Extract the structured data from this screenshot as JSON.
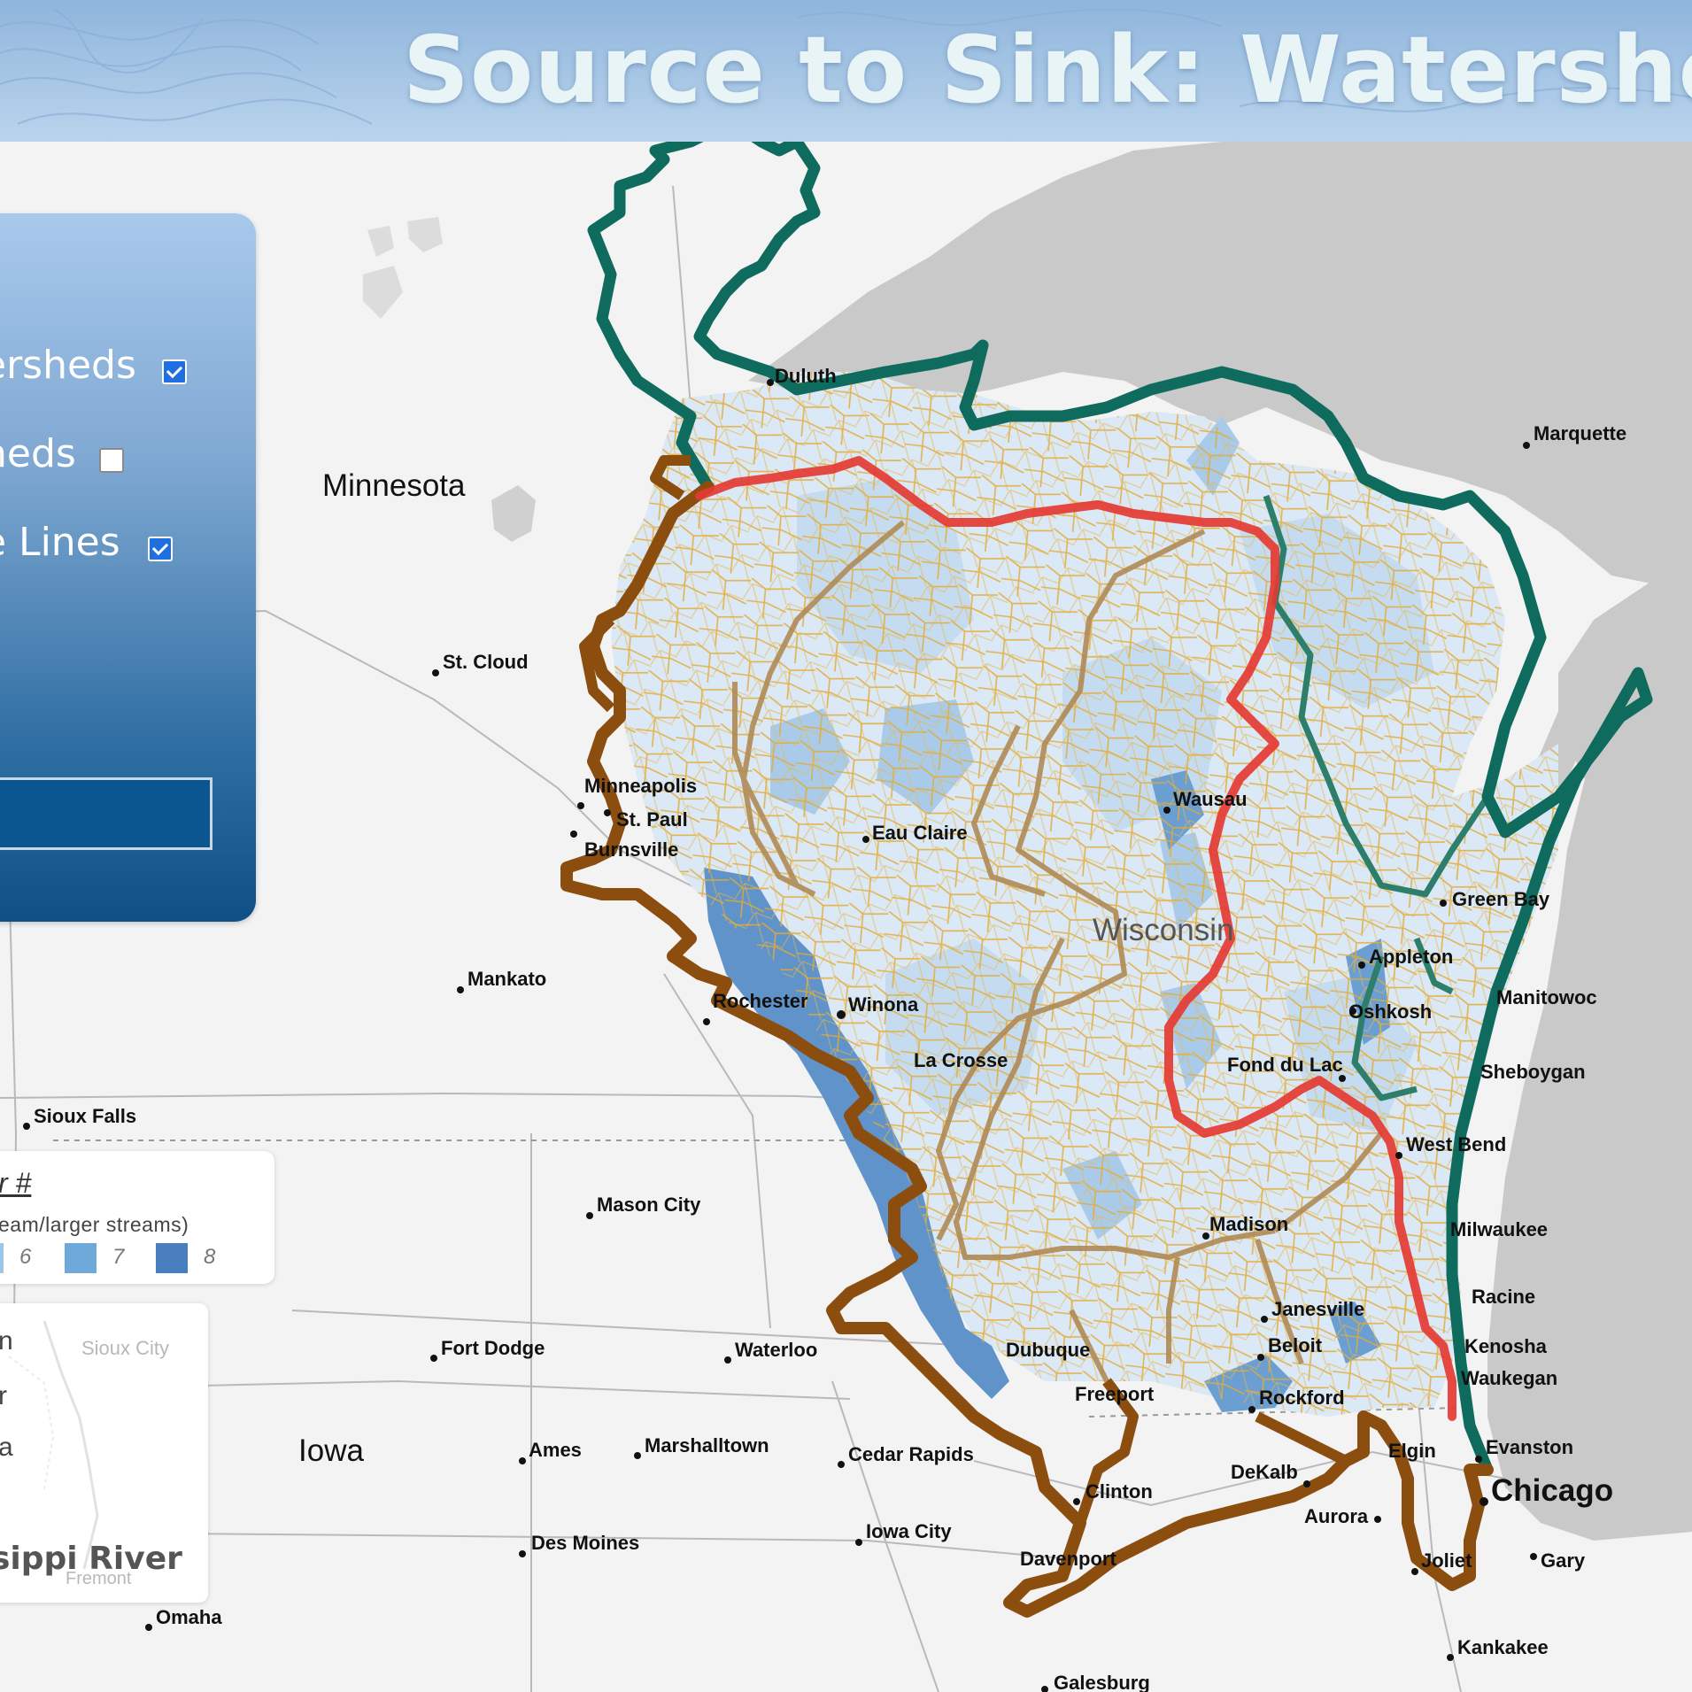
{
  "header": {
    "title": "Source to Sink: Watershed View"
  },
  "layers_panel": {
    "items": [
      {
        "label": "ersheds",
        "checked": true
      },
      {
        "label": "heds",
        "checked": false
      },
      {
        "label": "e Lines",
        "checked": true
      }
    ]
  },
  "legend": {
    "title": "r #",
    "subtitle": "eam/larger streams)",
    "classes": [
      {
        "label": "6",
        "color": "#9cc5e6"
      },
      {
        "label": "7",
        "color": "#6ea9d9"
      },
      {
        "label": "8",
        "color": "#4a7fbf"
      }
    ]
  },
  "overview_map": {
    "line1": "n",
    "line2": "r",
    "line3": "a",
    "river_label": "sippi River",
    "city1": "Sioux City",
    "city2": "Fremont"
  },
  "map": {
    "state_labels": [
      "Minnesota",
      "Iowa",
      "Wisconsin"
    ],
    "cities": [
      "Duluth",
      "Marquette",
      "St. Cloud",
      "Minneapolis",
      "St. Paul",
      "Burnsville",
      "Eau Claire",
      "Wausau",
      "Green Bay",
      "Appleton",
      "Oshkosh",
      "Manitowoc",
      "Sheboygan",
      "Fond du Lac",
      "West Bend",
      "Milwaukee",
      "Racine",
      "Kenosha",
      "Waukegan",
      "Evanston",
      "Chicago",
      "Gary",
      "Joliet",
      "Kankakee",
      "Elgin",
      "DeKalb",
      "Aurora",
      "Rockford",
      "Beloit",
      "Janesville",
      "Madison",
      "Freeport",
      "Dubuque",
      "Clinton",
      "Davenport",
      "Galesburg",
      "Iowa City",
      "Cedar Rapids",
      "Waterloo",
      "Marshalltown",
      "Ames",
      "Des Moines",
      "Fort Dodge",
      "Mason City",
      "Mankato",
      "Rochester",
      "Winona",
      "La Crosse",
      "Sioux Falls",
      "Omaha"
    ],
    "colors": {
      "outer_basin_green": "#0f6b5e",
      "mississippi_brown": "#8b4e0f",
      "divide_red": "#ef3b33",
      "subwatershed_lines": "#e0aa2e",
      "lake": "#c8c8c8"
    }
  }
}
